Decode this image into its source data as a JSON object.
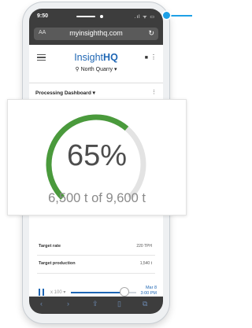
{
  "status_bar": {
    "time": "9:50",
    "right_icons": ".ıl ᯤ ▭"
  },
  "browser": {
    "aa_label": "AA",
    "url": "myinsighthq.com",
    "reload_icon": "reload-icon"
  },
  "app": {
    "brand_prefix": "Insight",
    "brand_suffix": "HQ",
    "location": "North Quarry",
    "location_caret": "▾"
  },
  "dashboard": {
    "title": "Processing Dashboard",
    "caret": "▾"
  },
  "gauge": {
    "percent_label": "65%",
    "progress_fraction": 0.65,
    "subtitle": "6,500 t of 9,600 t",
    "fill_color": "#4a9a3c",
    "track_color": "#e3e3e3"
  },
  "metrics": [
    {
      "label": "Target rate",
      "value": "220 TPH"
    },
    {
      "label": "Target production",
      "value": "1,540 t"
    }
  ],
  "playback": {
    "speed": "x 100",
    "speed_caret": "▾",
    "progress_fraction": 0.85,
    "date": "Mar 8",
    "time": "3:00 PM"
  },
  "colors": {
    "brand_blue": "#1e66b4",
    "callout": "#1ea0e6"
  }
}
